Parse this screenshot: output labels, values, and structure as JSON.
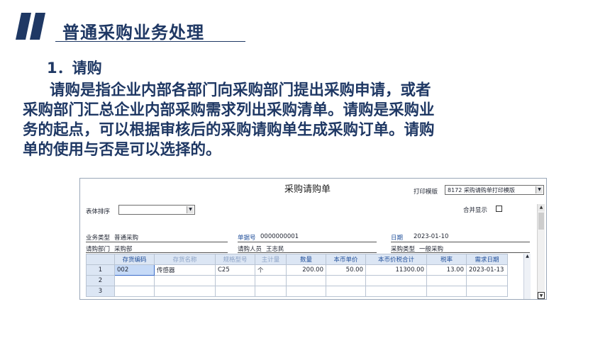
{
  "slide": {
    "section_title": "普通采购业务处理",
    "sub_heading": "1．请购",
    "paragraph_lines": [
      "请购是指企业内部各部门向采购部门提出采购申请，或者",
      "采购部门汇总企业内部采购需求列出采购清单。请购是采购业",
      "务的起点，可以根据审核后的采购请购单生成采购订单。请购",
      "单的使用与否是可以选择的。"
    ]
  },
  "form": {
    "title": "采购请购单",
    "print_template_label": "打印模版",
    "print_template_value": "8172 采购请购单打印模版",
    "sort_label": "表体排序",
    "sort_value": "",
    "merge_display_label": "合并显示",
    "business_type_label": "业务类型",
    "business_type_value": "普通采购",
    "doc_no_label": "单据号",
    "doc_no_value": "0000000001",
    "date_label": "日期",
    "date_value": "2023-01-10",
    "dept_label": "请购部门",
    "dept_value": "采购部",
    "requester_label": "请购人员",
    "requester_value": "王志民",
    "purchase_type_label": "采购类型",
    "purchase_type_value": "一般采购"
  },
  "grid": {
    "headers": [
      "",
      "存货编码",
      "存货名称",
      "规格型号",
      "主计量",
      "数量",
      "本币单价",
      "本币价税合计",
      "税率",
      "需求日期"
    ],
    "rows": [
      [
        "1",
        "002",
        "传感器",
        "C25",
        "个",
        "200.00",
        "50.00",
        "11300.00",
        "13.00",
        "2023-01-13"
      ],
      [
        "2",
        "",
        "",
        "",
        "",
        "",
        "",
        "",
        "",
        ""
      ],
      [
        "3",
        "",
        "",
        "",
        "",
        "",
        "",
        "",
        "",
        ""
      ]
    ]
  },
  "colors": {
    "brand": "#1f3864",
    "grid_header": "#dce6f4",
    "grid_header_text": "#1f4e9a"
  }
}
